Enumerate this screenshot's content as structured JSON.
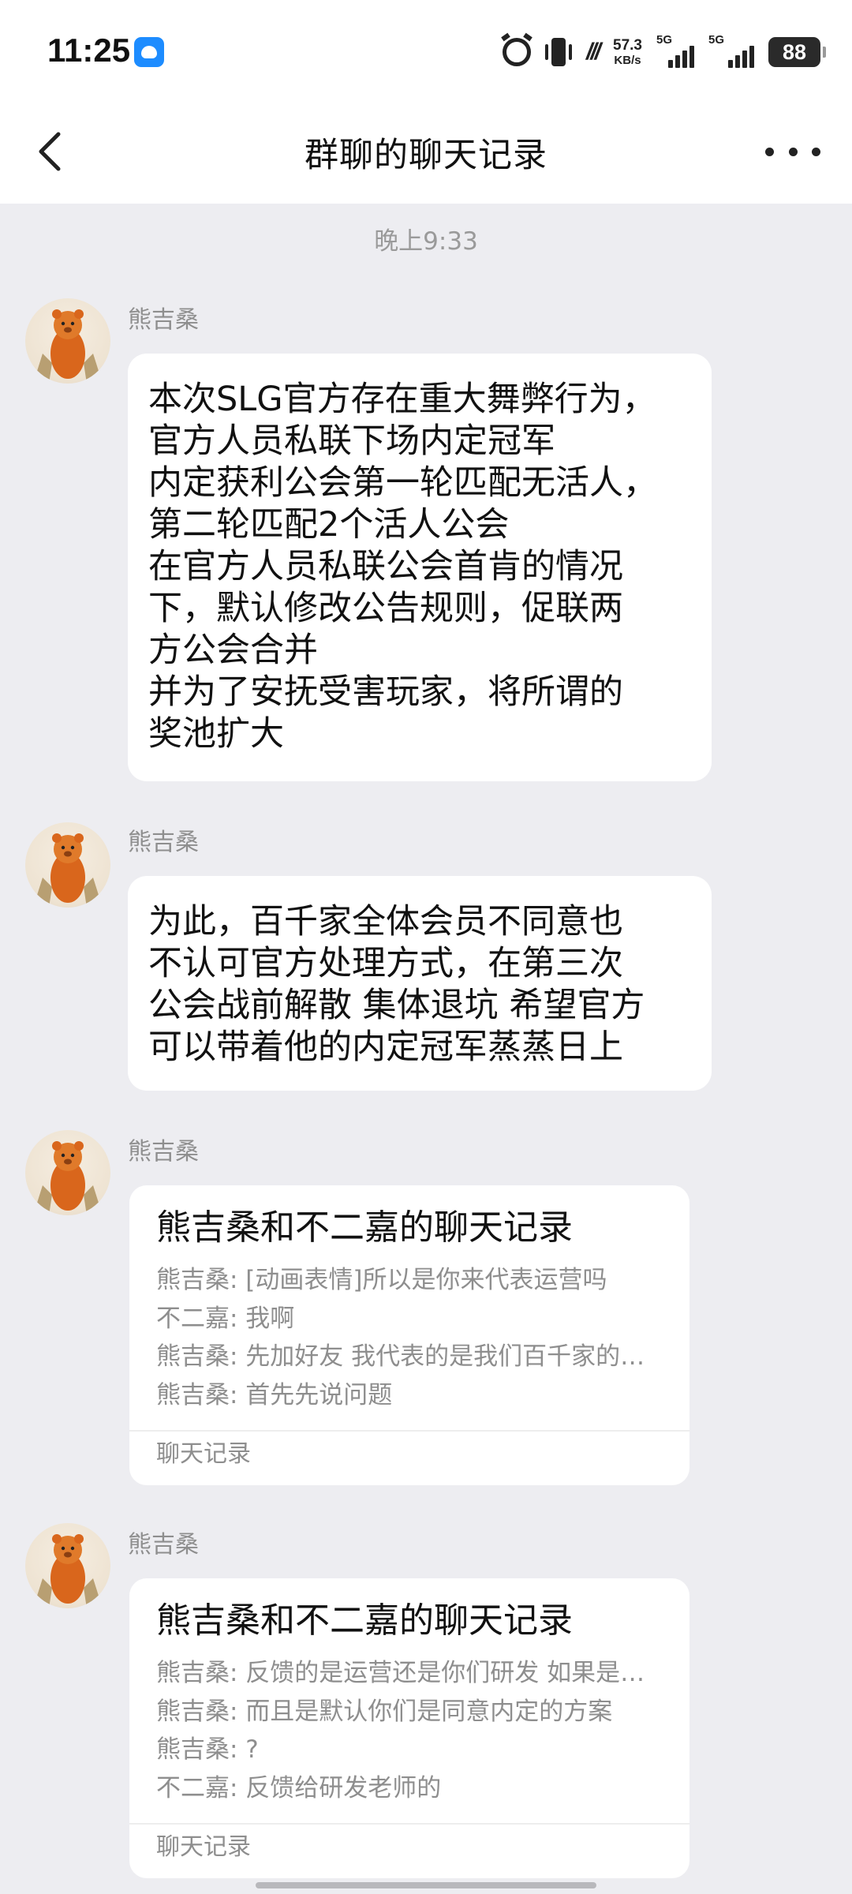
{
  "status_bar": {
    "time": "11:25",
    "net_speed_value": "57.3",
    "net_speed_unit": "KB/s",
    "sim1_tag": "5G",
    "sim2_tag": "5G",
    "battery": "88",
    "icons": [
      "app-notification-icon",
      "alarm-icon",
      "vibrate-icon",
      "hd-icon",
      "signal-icon",
      "signal-icon",
      "battery-icon"
    ]
  },
  "header": {
    "title": "群聊的聊天记录",
    "back_icon": "chevron-left-icon",
    "more_icon": "more-horizontal-icon"
  },
  "timestamp": "晚上9:33",
  "messages": [
    {
      "sender": "熊吉桑",
      "type": "text",
      "text": "本次SLG官方存在重大舞弊行为，\n官方人员私联下场内定冠军\n内定获利公会第一轮匹配无活人，\n第二轮匹配2个活人公会\n在官方人员私联公会首肯的情况\n下，默认修改公告规则，促联两\n方公会合并\n并为了安抚受害玩家，将所谓的\n奖池扩大"
    },
    {
      "sender": "熊吉桑",
      "type": "text",
      "text": "为此，百千家全体会员不同意也\n不认可官方处理方式，在第三次\n公会战前解散 集体退坑 希望官方\n可以带着他的内定冠军蒸蒸日上"
    },
    {
      "sender": "熊吉桑",
      "type": "chat_record",
      "card": {
        "title": "熊吉桑和不二嘉的聊天记录",
        "lines": [
          "熊吉桑: [动画表情]所以是你来代表运营吗",
          "不二嘉: 我啊",
          "熊吉桑: 先加好友 我代表的是我们百千家的…",
          "熊吉桑: 首先先说问题"
        ],
        "footer": "聊天记录"
      }
    },
    {
      "sender": "熊吉桑",
      "type": "chat_record",
      "card": {
        "title": "熊吉桑和不二嘉的聊天记录",
        "lines": [
          "熊吉桑: 反馈的是运营还是你们研发 如果是…",
          "熊吉桑: 而且是默认你们是同意内定的方案",
          "熊吉桑: ?",
          "不二嘉: 反馈给研发老师的"
        ],
        "footer": "聊天记录"
      }
    }
  ]
}
